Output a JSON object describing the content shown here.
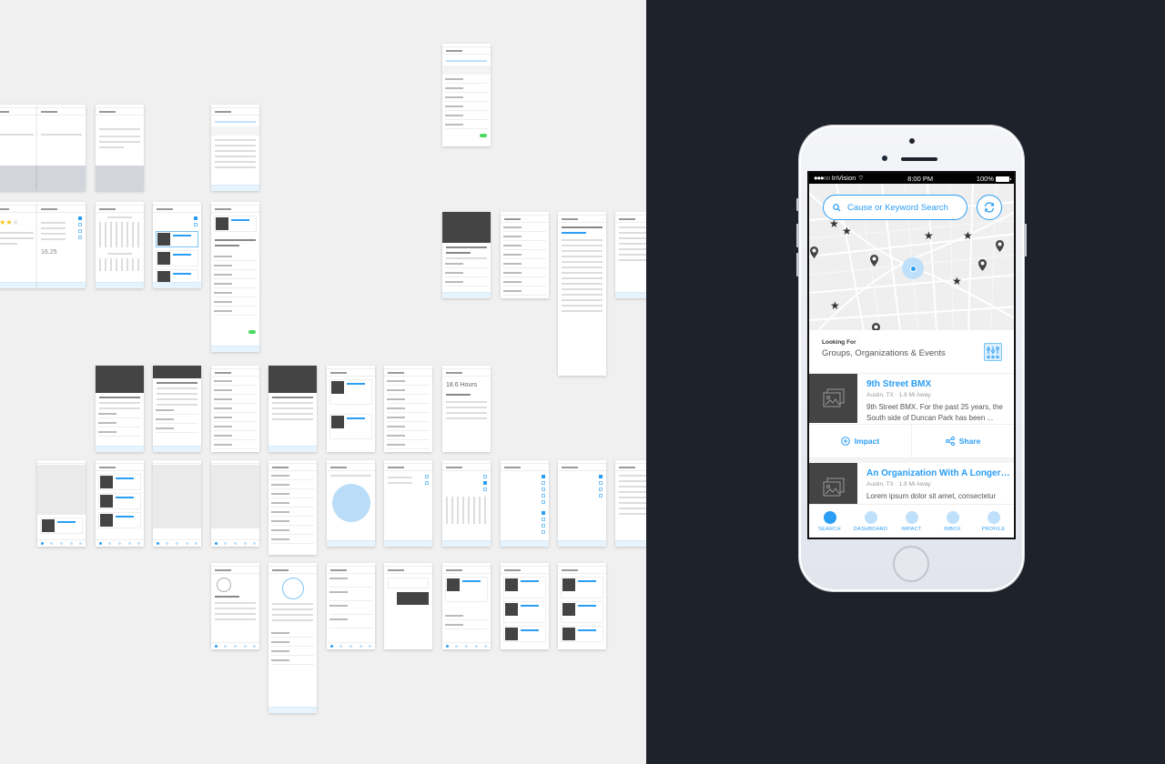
{
  "phone": {
    "status_bar": {
      "carrier": "InVision",
      "signal": "●●●○○",
      "time": "8:00 PM",
      "battery": "100%"
    },
    "search": {
      "placeholder": "Cause or Keyword Search",
      "icon": "search-icon",
      "refresh_icon": "refresh-icon"
    },
    "looking_for": {
      "label": "Looking For",
      "value": "Groups, Organizations & Events",
      "filter_icon": "sliders-icon"
    },
    "results": [
      {
        "title": "9th Street BMX",
        "location": "Austin, TX · 1.8 Mi Away",
        "description": "9th Street BMX. For the past 25 years, the South side of Duncan Park has been ..."
      },
      {
        "title": "An Organization With A Longer N...",
        "location": "Austin, TX · 1.8 Mi Away",
        "description": "Lorem ipsum dolor sit amet, consectetur adipiscing elit. Praesent sed tincidunt orci"
      }
    ],
    "actions": {
      "impact": "Impact",
      "share": "Share"
    },
    "tabs": [
      {
        "label": "SEARCH",
        "active": true
      },
      {
        "label": "DASHBOARD",
        "active": false
      },
      {
        "label": "IMPACT",
        "active": false
      },
      {
        "label": "INBOX",
        "active": false
      },
      {
        "label": "PROFILE",
        "active": false
      }
    ]
  },
  "colors": {
    "accent": "#2a9df4",
    "accent_light": "#bfe0fb",
    "left_bg": "#f0f0f0",
    "right_bg": "#1e222b",
    "placeholder_image": "#444444"
  },
  "wireframes": {
    "count": 47,
    "description": "Grid of app screen wireframe thumbnails"
  }
}
